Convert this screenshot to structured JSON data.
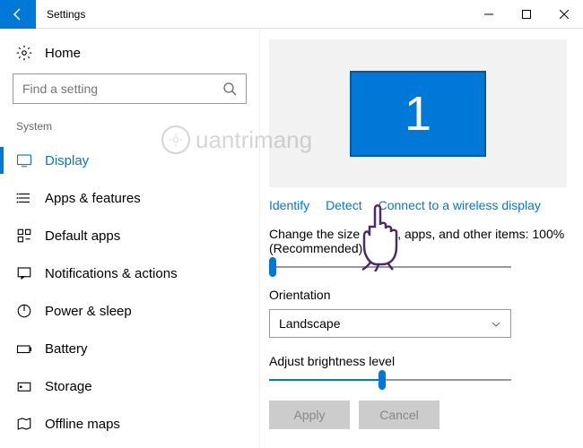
{
  "titlebar": {
    "title": "Settings"
  },
  "sidebar": {
    "home": "Home",
    "search_placeholder": "Find a setting",
    "section": "System",
    "items": [
      {
        "label": "Display",
        "active": true
      },
      {
        "label": "Apps & features"
      },
      {
        "label": "Default apps"
      },
      {
        "label": "Notifications & actions"
      },
      {
        "label": "Power & sleep"
      },
      {
        "label": "Battery"
      },
      {
        "label": "Storage"
      },
      {
        "label": "Offline maps"
      }
    ]
  },
  "main": {
    "monitor_number": "1",
    "links": {
      "identify": "Identify",
      "detect": "Detect",
      "connect": "Connect to a wireless display"
    },
    "size_label_line1": "Change the size of text, apps, and other items: 100%",
    "size_label_line2": "(Recommended)",
    "orientation_label": "Orientation",
    "orientation_value": "Landscape",
    "brightness_label": "Adjust brightness level",
    "apply": "Apply",
    "cancel": "Cancel"
  },
  "watermark": "uantrimang"
}
